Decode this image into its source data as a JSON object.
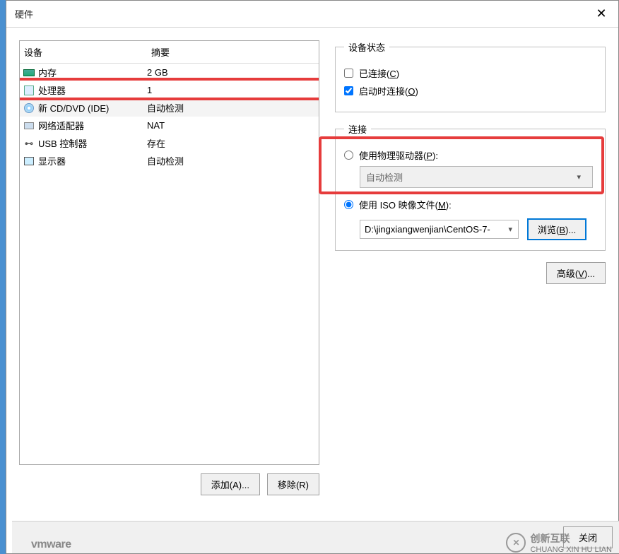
{
  "title": "硬件",
  "columns": {
    "device": "设备",
    "summary": "摘要"
  },
  "devices": [
    {
      "icon": "ic-mem",
      "name": "内存",
      "summary": "2 GB"
    },
    {
      "icon": "ic-cpu",
      "name": "处理器",
      "summary": "1"
    },
    {
      "icon": "ic-cd",
      "name": "新 CD/DVD (IDE)",
      "summary": "自动检测",
      "selected": true
    },
    {
      "icon": "ic-net",
      "name": "网络适配器",
      "summary": "NAT"
    },
    {
      "icon": "ic-usb",
      "name": "USB 控制器",
      "summary": "存在"
    },
    {
      "icon": "ic-mon",
      "name": "显示器",
      "summary": "自动检测"
    }
  ],
  "buttons": {
    "add": "添加(A)...",
    "remove": "移除(R)",
    "browse": "浏览(B)...",
    "advanced": "高级(V)...",
    "close": "关闭"
  },
  "status": {
    "legend": "设备状态",
    "connected": "已连接(C)",
    "connect_on_power": "启动时连接(O)",
    "connect_on_power_checked": true
  },
  "connection": {
    "legend": "连接",
    "physical": "使用物理驱动器(P):",
    "physical_value": "自动检测",
    "iso": "使用 ISO 映像文件(M):",
    "iso_path": "D:\\jingxiangwenjian\\CentOS-7-",
    "selected": "iso"
  },
  "watermark": {
    "text1": "创新互联",
    "text2": "CHUANG XIN HU LIAN",
    "vmware": "vmware"
  }
}
